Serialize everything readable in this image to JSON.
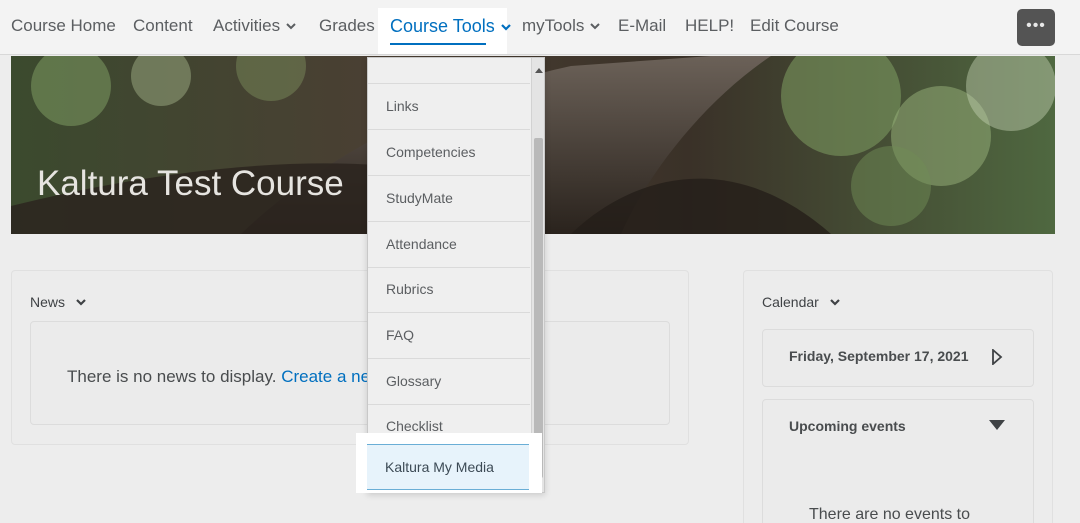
{
  "nav": {
    "items": [
      {
        "label": "Course Home"
      },
      {
        "label": "Content"
      },
      {
        "label": "Activities"
      },
      {
        "label": "Grades"
      },
      {
        "label": "Course Tools"
      },
      {
        "label": "myTools"
      },
      {
        "label": "E-Mail"
      },
      {
        "label": "HELP!"
      },
      {
        "label": "Edit Course"
      }
    ],
    "more_label": "•••",
    "active_color": "#006fbf"
  },
  "banner": {
    "title": "Kaltura Test Course"
  },
  "news": {
    "title": "News",
    "empty_text": "There is no news to display.",
    "create_link": "Create a ne"
  },
  "calendar": {
    "title": "Calendar",
    "date": "Friday, September 17, 2021",
    "upcoming_label": "Upcoming events",
    "empty_text": "There are no events to"
  },
  "course_tools_menu": {
    "items": [
      {
        "label": "Links"
      },
      {
        "label": "Competencies"
      },
      {
        "label": "StudyMate"
      },
      {
        "label": "Attendance"
      },
      {
        "label": "Rubrics"
      },
      {
        "label": "FAQ"
      },
      {
        "label": "Glossary"
      },
      {
        "label": "Checklist"
      },
      {
        "label": "Kaltura My Media"
      }
    ],
    "selected": "Kaltura My Media"
  }
}
